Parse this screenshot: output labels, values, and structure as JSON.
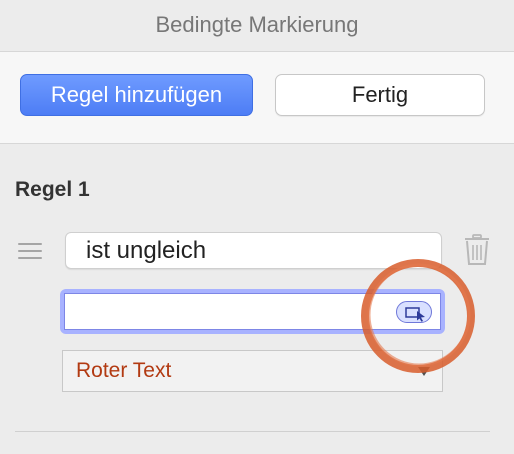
{
  "header": {
    "title": "Bedingte Markierung"
  },
  "toolbar": {
    "add_rule_label": "Regel hinzufügen",
    "done_label": "Fertig"
  },
  "rule": {
    "title": "Regel 1",
    "condition": "ist ungleich",
    "value": "",
    "format": "Roter Text"
  },
  "icons": {
    "drag_handle": "drag-handle-icon",
    "trash": "trash-icon",
    "cell_picker": "cell-picker-icon"
  },
  "colors": {
    "primary_button": "#4d7df5",
    "format_text": "#b23a12",
    "highlight_circle": "#d85d2c",
    "input_focus": "#a8b2ff"
  }
}
